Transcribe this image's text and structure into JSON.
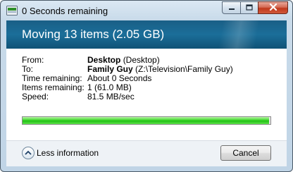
{
  "window": {
    "title": "0 Seconds remaining",
    "icons": {
      "app": "copy-progress-icon",
      "minimize": "minimize-icon",
      "maximize": "maximize-icon",
      "close": "close-icon"
    }
  },
  "header": {
    "title": "Moving 13 items (2.05 GB)"
  },
  "details": {
    "from": {
      "label": "From:",
      "name": "Desktop",
      "detail": "(Desktop)"
    },
    "to": {
      "label": "To:",
      "name": "Family Guy",
      "detail": "(Z:\\Television\\Family Guy)"
    },
    "time_remaining": {
      "label": "Time remaining:",
      "value": "About 0 Seconds"
    },
    "items_remaining": {
      "label": "Items remaining:",
      "value": "1 (61.0 MB)"
    },
    "speed": {
      "label": "Speed:",
      "value": "81.5 MB/sec"
    }
  },
  "progress": {
    "fraction": 0.995,
    "color": "#2bc81d"
  },
  "footer": {
    "less_info_label": "Less information",
    "less_info_icon": "chevron-up-icon",
    "cancel_label": "Cancel"
  }
}
